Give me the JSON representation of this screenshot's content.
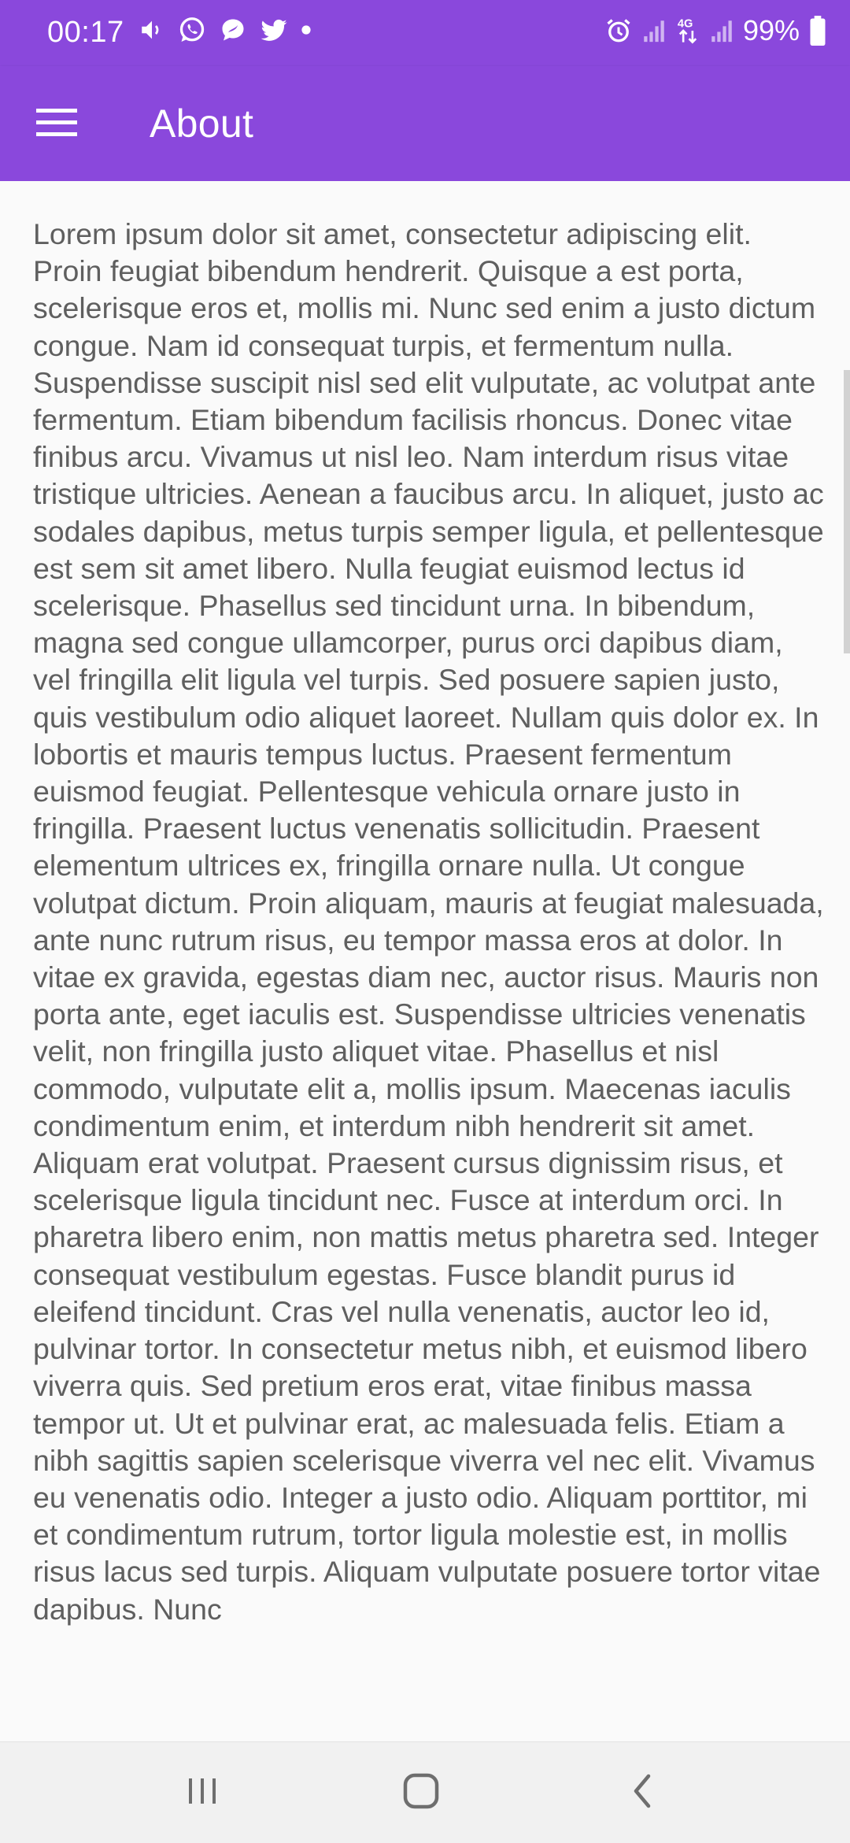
{
  "status_bar": {
    "time": "00:17",
    "left_icons": [
      "volume-icon",
      "whatsapp-icon",
      "chat-bubble-icon",
      "twitter-icon",
      "dot-icon"
    ],
    "right_icons": [
      "alarm-icon",
      "signal-icon",
      "network-4g-icon",
      "signal-icon"
    ],
    "battery_text": "99%"
  },
  "app_bar": {
    "menu_icon": "menu-icon",
    "title": "About"
  },
  "content": {
    "text": "Lorem ipsum dolor sit amet, consectetur adipiscing elit. Proin feugiat bibendum hendrerit. Quisque a est porta, scelerisque eros et, mollis mi. Nunc sed enim a justo dictum congue. Nam id consequat turpis, et fermentum nulla. Suspendisse suscipit nisl sed elit vulputate, ac volutpat ante fermentum. Etiam bibendum facilisis rhoncus. Donec vitae finibus arcu. Vivamus ut nisl leo. Nam interdum risus vitae tristique ultricies. Aenean a faucibus arcu. In aliquet, justo ac sodales dapibus, metus turpis semper ligula, et pellentesque est sem sit amet libero. Nulla feugiat euismod lectus id scelerisque. Phasellus sed tincidunt urna. In bibendum, magna sed congue ullamcorper, purus orci dapibus diam, vel fringilla elit ligula vel turpis. Sed posuere sapien justo, quis vestibulum odio aliquet laoreet. Nullam quis dolor ex. In lobortis et mauris tempus luctus. Praesent fermentum euismod feugiat. Pellentesque vehicula ornare justo in fringilla. Praesent luctus venenatis sollicitudin. Praesent elementum ultrices ex, fringilla ornare nulla. Ut congue volutpat dictum. Proin aliquam, mauris at feugiat malesuada, ante nunc rutrum risus, eu tempor massa eros at dolor. In vitae ex gravida, egestas diam nec, auctor risus. Mauris non porta ante, eget iaculis est. Suspendisse ultricies venenatis velit, non fringilla justo aliquet vitae. Phasellus et nisl commodo, vulputate elit a, mollis ipsum. Maecenas iaculis condimentum enim, et interdum nibh hendrerit sit amet. Aliquam erat volutpat. Praesent cursus dignissim risus, et scelerisque ligula tincidunt nec. Fusce at interdum orci. In pharetra libero enim, non mattis metus pharetra sed. Integer consequat vestibulum egestas. Fusce blandit purus id eleifend tincidunt. Cras vel nulla venenatis, auctor leo id, pulvinar tortor. In consectetur metus nibh, et euismod libero viverra quis. Sed pretium eros erat, vitae finibus massa tempor ut. Ut et pulvinar erat, ac malesuada felis. Etiam a nibh sagittis sapien scelerisque viverra vel nec elit. Vivamus eu venenatis odio. Integer a justo odio. Aliquam porttitor, mi et condimentum rutrum, tortor ligula molestie est, in mollis risus lacus sed turpis. Aliquam vulputate posuere tortor vitae dapibus. Nunc"
  },
  "nav_bar": {
    "buttons": [
      "recents-icon",
      "home-icon",
      "back-icon"
    ]
  },
  "colors": {
    "primary": "#8a48dc",
    "background": "#fafafa",
    "body_text": "#5f5f5f",
    "nav_bar": "#f1f1f1",
    "nav_icon": "#6e6e6e"
  }
}
